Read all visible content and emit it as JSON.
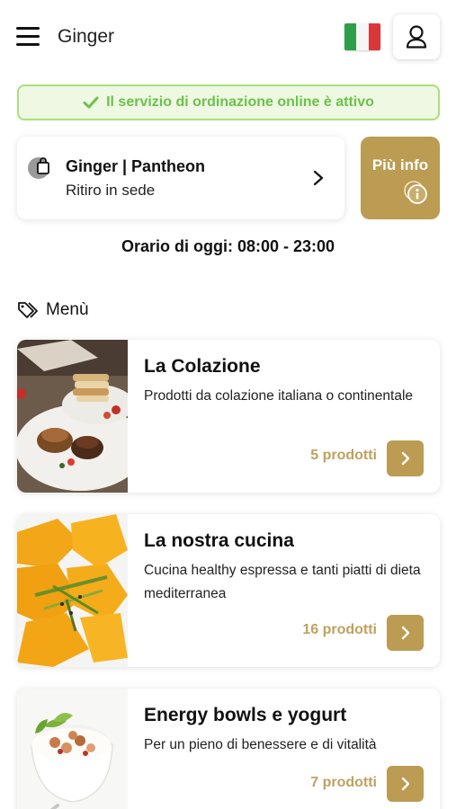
{
  "header": {
    "title": "Ginger",
    "menu_icon": "hamburger-menu-icon",
    "language_flag": "italian-flag",
    "user_icon": "user-icon"
  },
  "status_banner": {
    "text": "Il servizio di ordinazione online è attivo",
    "icon": "check-icon",
    "color": "#6cc24a"
  },
  "store": {
    "name": "Ginger | Pantheon",
    "mode": "Ritiro in sede",
    "icon": "shopping-bag-icon"
  },
  "info_button": {
    "label": "Più info",
    "icon": "info-icon",
    "color": "#bc9b52"
  },
  "hours": "Orario di oggi: 08:00 - 23:00",
  "menu": {
    "heading": "Menù",
    "icon": "tags-icon",
    "categories": [
      {
        "title": "La Colazione",
        "description": "Prodotti da colazione italiana o continentale",
        "count": "5 prodotti",
        "image": "breakfast-photo"
      },
      {
        "title": "La nostra cucina",
        "description": "Cucina healthy espressa e tanti piatti di dieta mediterranea",
        "count": "16 prodotti",
        "image": "ravioli-photo"
      },
      {
        "title": "Energy bowls e yogurt",
        "description": "Per un pieno di benessere e di vitalità",
        "count": "7 prodotti",
        "image": "yogurt-bowl-photo"
      }
    ]
  },
  "colors": {
    "accent": "#bc9b52",
    "success": "#6cc24a",
    "success_bg": "#eef8e3"
  }
}
